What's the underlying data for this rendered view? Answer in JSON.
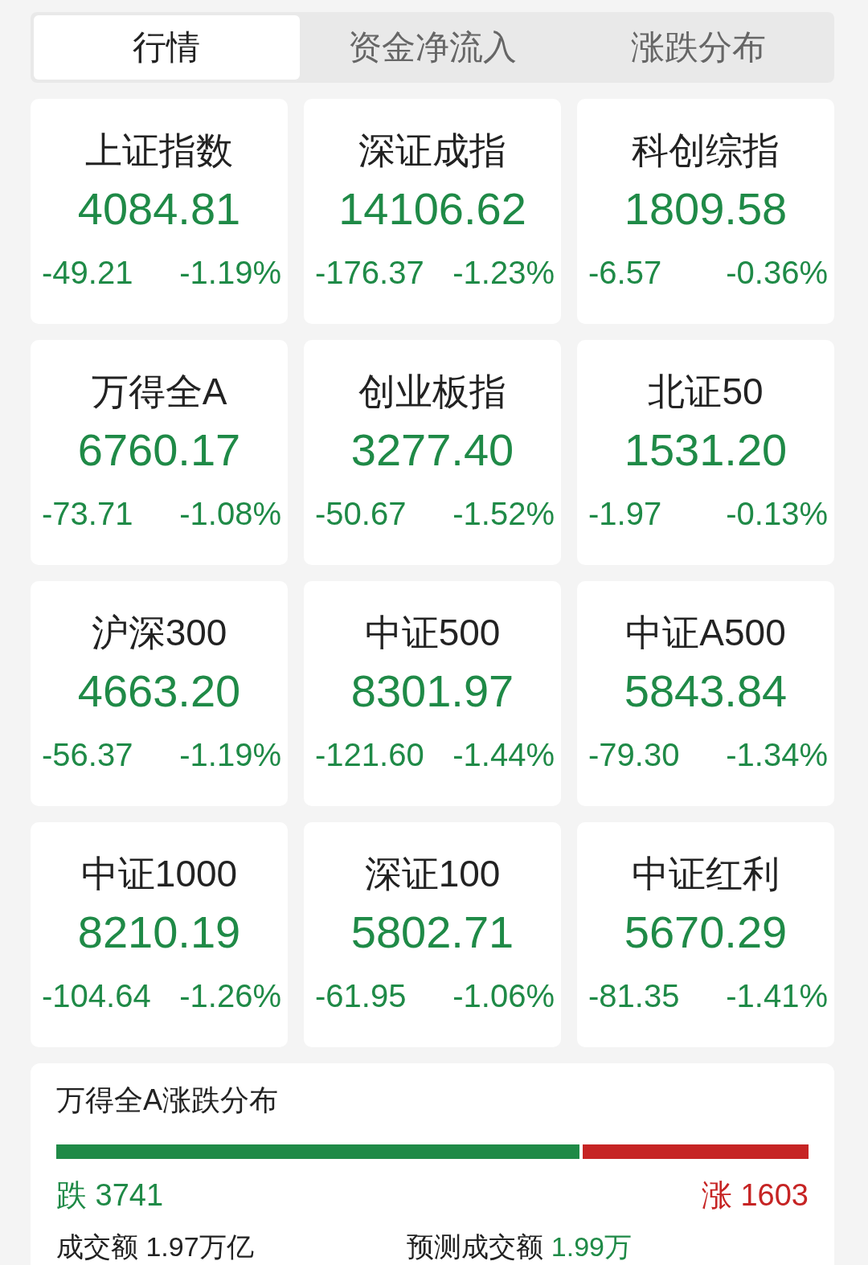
{
  "tabs": [
    {
      "label": "行情",
      "selected": true
    },
    {
      "label": "资金净流入",
      "selected": false
    },
    {
      "label": "涨跌分布",
      "selected": false
    }
  ],
  "indices": [
    {
      "name": "上证指数",
      "price": "4084.81",
      "change": "-49.21",
      "percent": "-1.19%",
      "color": "#1f8a47"
    },
    {
      "name": "深证成指",
      "price": "14106.62",
      "change": "-176.37",
      "percent": "-1.23%",
      "color": "#1f8a47"
    },
    {
      "name": "科创综指",
      "price": "1809.58",
      "change": "-6.57",
      "percent": "-0.36%",
      "color": "#1f8a47"
    },
    {
      "name": "万得全A",
      "price": "6760.17",
      "change": "-73.71",
      "percent": "-1.08%",
      "color": "#1f8a47"
    },
    {
      "name": "创业板指",
      "price": "3277.40",
      "change": "-50.67",
      "percent": "-1.52%",
      "color": "#1f8a47"
    },
    {
      "name": "北证50",
      "price": "1531.20",
      "change": "-1.97",
      "percent": "-0.13%",
      "color": "#1f8a47"
    },
    {
      "name": "沪深300",
      "price": "4663.20",
      "change": "-56.37",
      "percent": "-1.19%",
      "color": "#1f8a47"
    },
    {
      "name": "中证500",
      "price": "8301.97",
      "change": "-121.60",
      "percent": "-1.44%",
      "color": "#1f8a47"
    },
    {
      "name": "中证A500",
      "price": "5843.84",
      "change": "-79.30",
      "percent": "-1.34%",
      "color": "#1f8a47"
    },
    {
      "name": "中证1000",
      "price": "8210.19",
      "change": "-104.64",
      "percent": "-1.26%",
      "color": "#1f8a47"
    },
    {
      "name": "深证100",
      "price": "5802.71",
      "change": "-61.95",
      "percent": "-1.06%",
      "color": "#1f8a47"
    },
    {
      "name": "中证红利",
      "price": "5670.29",
      "change": "-81.35",
      "percent": "-1.41%",
      "color": "#1f8a47"
    }
  ],
  "distribution": {
    "title": "万得全A涨跌分布",
    "level": 0.7,
    "down_label": "跌 3741",
    "up_label": "涨 1603",
    "turnover_label": "成交额",
    "turnover": "1.97万亿",
    "forecast_label": "预测成交额",
    "forecast": "1.99万"
  }
}
